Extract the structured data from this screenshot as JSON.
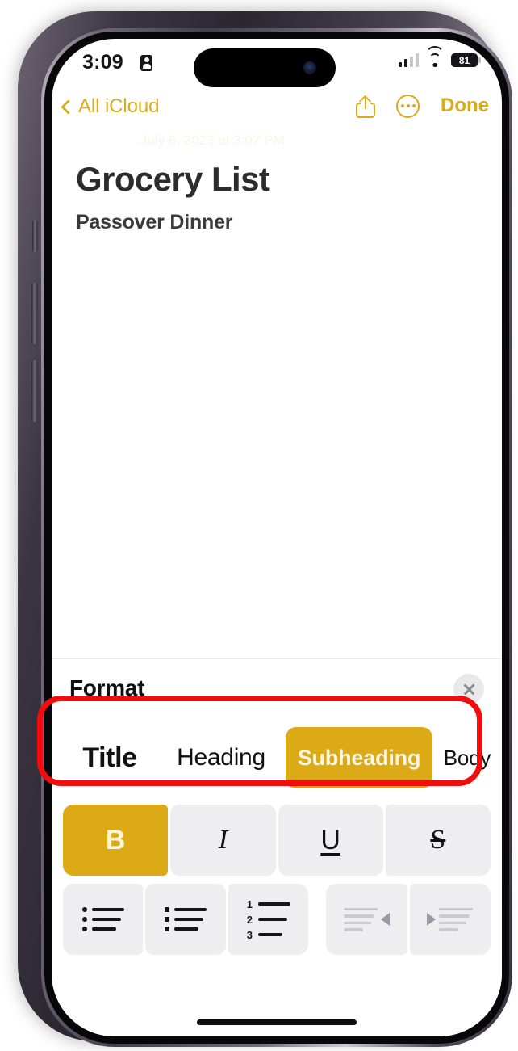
{
  "status_bar": {
    "time": "3:09",
    "lock_icon": "contact-badge-icon",
    "signal_icon": "cellular-signal-icon",
    "wifi_icon": "wifi-icon",
    "battery_level": "81"
  },
  "nav_bar": {
    "back_label": "All iCloud",
    "back_icon": "chevron-left-icon",
    "share_icon": "share-icon",
    "more_icon": "ellipsis-circle-icon",
    "done_label": "Done"
  },
  "note": {
    "date": "July 6, 2023 at 3:07 PM",
    "title": "Grocery List",
    "subheading": "Passover Dinner"
  },
  "format_sheet": {
    "title": "Format",
    "close_icon": "close-icon",
    "styles": [
      {
        "label": "Title",
        "selected": false
      },
      {
        "label": "Heading",
        "selected": false
      },
      {
        "label": "Subheading",
        "selected": true
      },
      {
        "label": "Body",
        "selected": false
      }
    ],
    "text_styles": [
      {
        "label": "B",
        "name": "bold-button",
        "selected": true
      },
      {
        "label": "I",
        "name": "italic-button",
        "selected": false
      },
      {
        "label": "U",
        "name": "underline-button",
        "selected": false
      },
      {
        "label": "S",
        "name": "strikethrough-button",
        "selected": false
      }
    ],
    "list_buttons": [
      {
        "name": "bulleted-list-button",
        "icon": "dashed-bullet-list-icon"
      },
      {
        "name": "dotted-list-button",
        "icon": "square-bullet-list-icon"
      },
      {
        "name": "numbered-list-button",
        "icon": "numbered-list-icon"
      }
    ],
    "indent_buttons": [
      {
        "name": "outdent-button",
        "icon": "outdent-icon",
        "disabled": true
      },
      {
        "name": "indent-button",
        "icon": "indent-icon",
        "disabled": true
      }
    ]
  },
  "annotation": {
    "name": "red-highlight-box",
    "color": "#f20d0d",
    "target": "paragraph-style-row"
  },
  "colors": {
    "accent_gold": "#d9ab1f",
    "selected_gold": "#dca917",
    "button_gray": "#eeeef1",
    "annotation_red": "#f20d0d"
  }
}
